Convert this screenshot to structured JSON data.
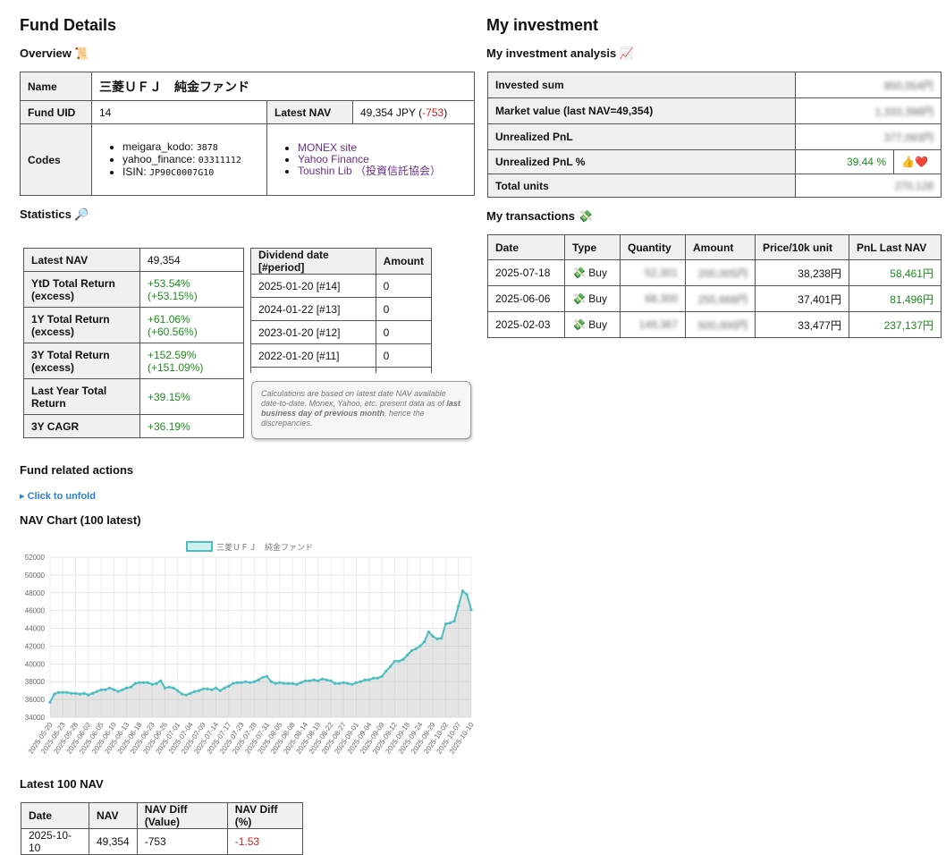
{
  "left": {
    "title": "Fund Details",
    "overview": {
      "heading": "Overview 📜",
      "name_label": "Name",
      "name_value": "三菱ＵＦＪ　純金ファンド",
      "uid_label": "Fund UID",
      "uid_value": "14",
      "nav_label": "Latest NAV",
      "nav_value": "49,354 JPY (",
      "nav_change": "-753",
      "nav_close": ")",
      "codes_label": "Codes",
      "codes": [
        {
          "key": "meigara_kodo: ",
          "val": "3878"
        },
        {
          "key": "yahoo_finance: ",
          "val": "03311112"
        },
        {
          "key": "ISIN: ",
          "val": "JP90C0007G10"
        }
      ],
      "links": [
        "MONEX site",
        "Yahoo Finance",
        "Toushin Lib （投資信託協会）"
      ]
    },
    "statistics": {
      "heading": "Statistics 🔎",
      "rows": [
        {
          "label": "Latest NAV",
          "value": "49,354",
          "excess": ""
        },
        {
          "label": "YtD Total Return (excess)",
          "value": "+53.54%",
          "excess": "(+53.15%)"
        },
        {
          "label": "1Y Total Return (excess)",
          "value": "+61.06%",
          "excess": "(+60.56%)"
        },
        {
          "label": "3Y Total Return (excess)",
          "value": "+152.59%",
          "excess": "(+151.09%)"
        },
        {
          "label": "Last Year Total Return",
          "value": "+39.15%",
          "excess": ""
        },
        {
          "label": "3Y CAGR",
          "value": "+36.19%",
          "excess": ""
        }
      ],
      "dividend_headers": [
        "Dividend date [#period]",
        "Amount"
      ],
      "dividends": [
        {
          "date": "2025-01-20 [#14]",
          "amount": "0"
        },
        {
          "date": "2024-01-22 [#13]",
          "amount": "0"
        },
        {
          "date": "2023-01-20 [#12]",
          "amount": "0"
        },
        {
          "date": "2022-01-20 [#11]",
          "amount": "0"
        }
      ],
      "note_a": "Calculations are based on latest date NAV available date-to-date. Monex, Yahoo, etc. present data as of ",
      "note_b": "last business day of previous month",
      "note_c": ", hence the discrepancies."
    },
    "actions": {
      "heading": "Fund related actions",
      "unfold": "▸ Click to unfold"
    },
    "chart_heading": "NAV Chart (100 latest)",
    "latest_nav": {
      "heading": "Latest 100 NAV",
      "headers": [
        "Date",
        "NAV",
        "NAV Diff (Value)",
        "NAV Diff (%)"
      ],
      "rows": [
        {
          "date": "2025-10-10",
          "nav": "49,354",
          "diff": "-753",
          "pct": "-1.53"
        }
      ]
    }
  },
  "right": {
    "title": "My investment",
    "analysis": {
      "heading": "My investment analysis 📈",
      "rows": [
        {
          "label": "Invested sum",
          "value": "850,054円"
        },
        {
          "label": "Market value (last NAV=49,354)",
          "value": "1,333,398円"
        },
        {
          "label": "Unrealized PnL",
          "value": "377,093円"
        },
        {
          "label": "Unrealized PnL %",
          "value": "39.44 %",
          "extra": "👍❤️"
        },
        {
          "label": "Total units",
          "value": "270,128"
        }
      ]
    },
    "transactions": {
      "heading": "My transactions 💸",
      "headers": [
        "Date",
        "Type",
        "Quantity",
        "Amount",
        "Price/10k unit",
        "PnL Last NAV"
      ],
      "rows": [
        {
          "date": "2025-07-18",
          "type": "💸 Buy",
          "qty": "52,301",
          "amount": "200,005円",
          "price": "38,238円",
          "pnl": "58,461円"
        },
        {
          "date": "2025-06-06",
          "type": "💸 Buy",
          "qty": "68,300",
          "amount": "255,668円",
          "price": "37,401円",
          "pnl": "81,496円"
        },
        {
          "date": "2025-02-03",
          "type": "💸 Buy",
          "qty": "149,367",
          "amount": "500,000円",
          "price": "33,477円",
          "pnl": "237,137円"
        }
      ]
    }
  },
  "chart_data": {
    "type": "line",
    "series": [
      {
        "name": "三菱ＵＦＪ　純金ファンド",
        "color": "#4bbfbf"
      }
    ],
    "ylim": [
      34000,
      52000
    ],
    "yticks": [
      34000,
      36000,
      38000,
      40000,
      42000,
      44000,
      46000,
      48000,
      50000,
      52000
    ],
    "xticks": [
      "2025-05-20",
      "2025-05-23",
      "2025-05-28",
      "2025-06-02",
      "2025-06-05",
      "2025-06-10",
      "2025-06-13",
      "2025-06-18",
      "2025-06-23",
      "2025-06-26",
      "2025-07-01",
      "2025-07-04",
      "2025-07-09",
      "2025-07-14",
      "2025-07-17",
      "2025-07-23",
      "2025-07-28",
      "2025-07-31",
      "2025-08-05",
      "2025-08-08",
      "2025-08-14",
      "2025-08-19",
      "2025-08-22",
      "2025-08-27",
      "2025-09-01",
      "2025-09-04",
      "2025-09-09",
      "2025-09-12",
      "2025-09-18",
      "2025-09-24",
      "2025-09-29",
      "2025-10-02",
      "2025-10-07",
      "2025-10-10"
    ],
    "values": [
      35700,
      36600,
      36800,
      36800,
      36800,
      36700,
      36700,
      36600,
      36700,
      36500,
      36700,
      36900,
      37100,
      37100,
      37300,
      37100,
      36900,
      37100,
      37300,
      37400,
      37800,
      37900,
      37900,
      37900,
      37700,
      37800,
      38100,
      37300,
      37400,
      37300,
      37000,
      36600,
      36500,
      36700,
      36900,
      37000,
      37200,
      37200,
      37100,
      37300,
      37000,
      37300,
      37500,
      37800,
      37900,
      37900,
      38000,
      37900,
      38000,
      38200,
      38500,
      38600,
      38000,
      37800,
      37900,
      37800,
      37800,
      37800,
      37700,
      37900,
      38100,
      38100,
      38200,
      38100,
      38300,
      38200,
      38100,
      37800,
      37800,
      37900,
      37800,
      37700,
      37900,
      38000,
      38200,
      38200,
      38400,
      38400,
      38600,
      39200,
      39700,
      40300,
      40300,
      40500,
      41000,
      41500,
      41700,
      42000,
      42500,
      43600,
      43100,
      42800,
      42900,
      44500,
      44600,
      44800,
      46500,
      48200,
      47800,
      46100
    ]
  }
}
